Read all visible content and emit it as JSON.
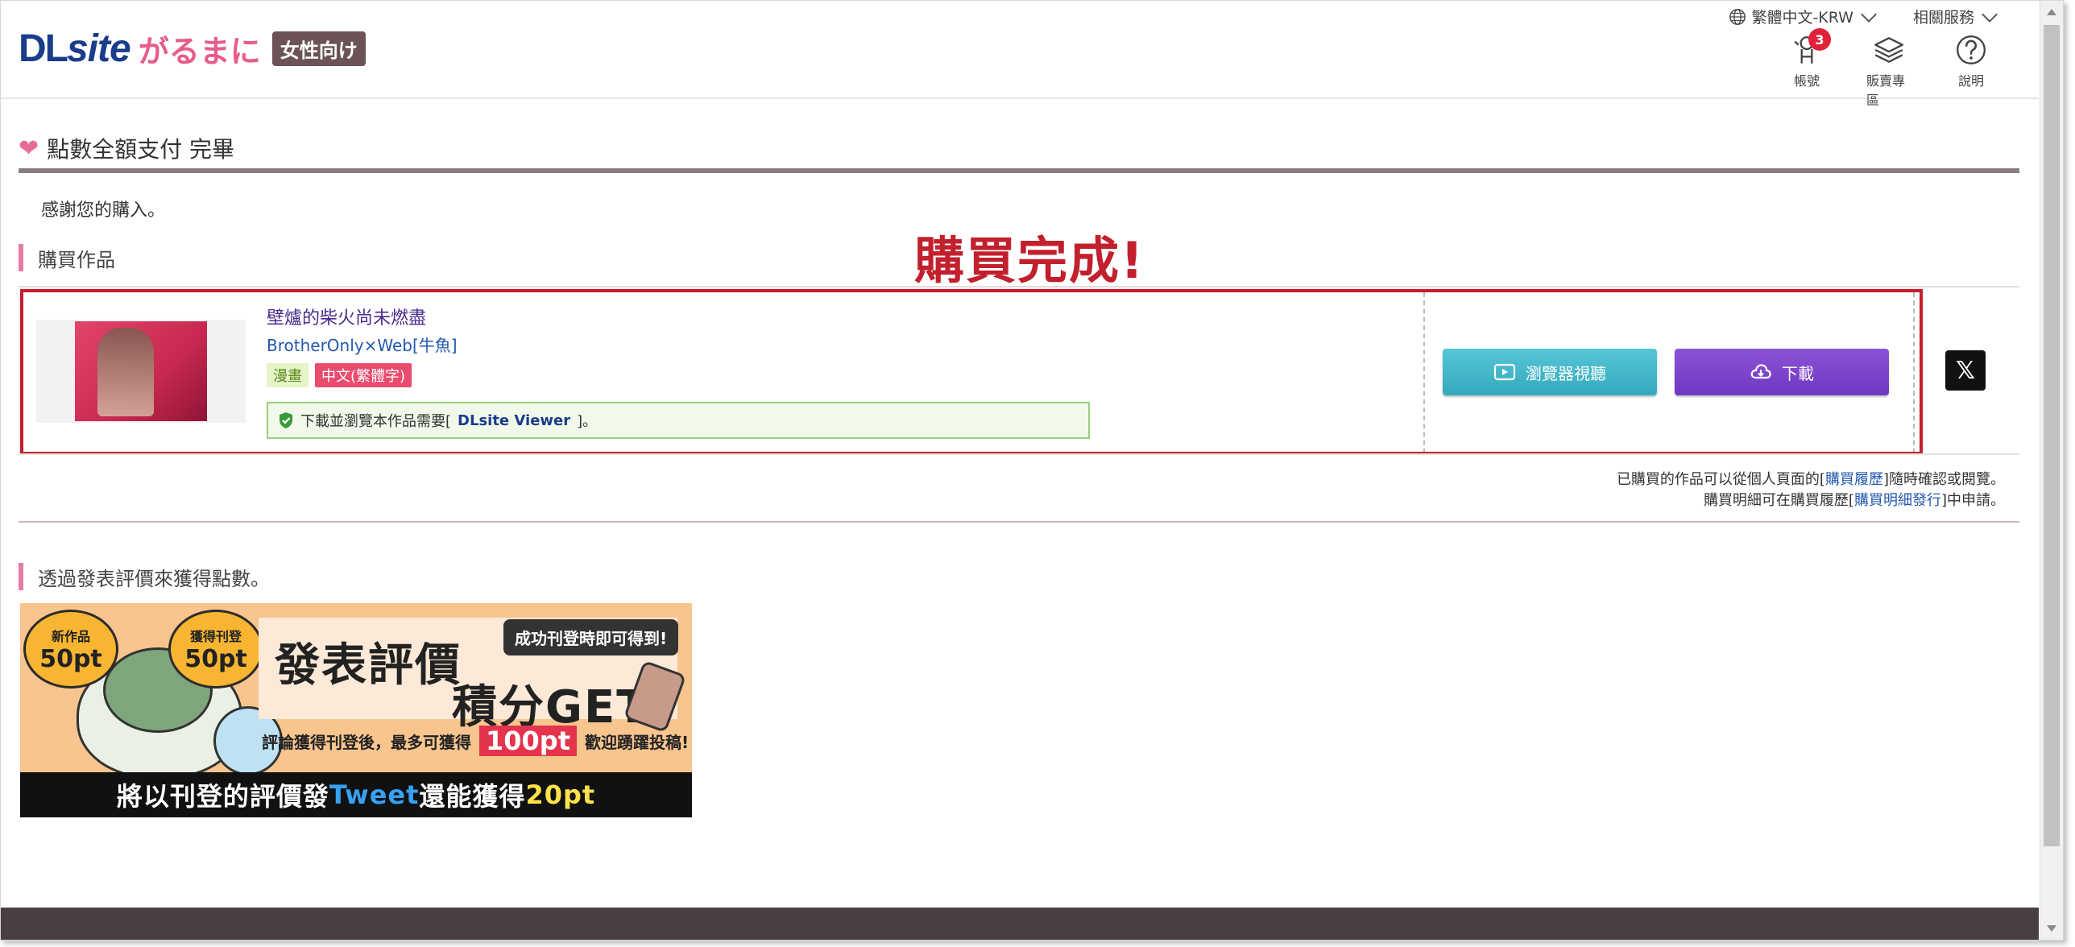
{
  "header": {
    "logo_dl": "DL",
    "logo_site": "site",
    "logo_brand": "がるまに",
    "logo_tag": "女性向け",
    "language": "繁體中文-KRW",
    "related_services": "相關服務",
    "icons": [
      {
        "name": "account-icon",
        "label": "帳號",
        "badge": "3"
      },
      {
        "name": "layers-icon",
        "label": "販賣專區"
      },
      {
        "name": "help-icon",
        "label": "說明"
      }
    ]
  },
  "page": {
    "title": "點數全額支付 完畢",
    "thanks": "感謝您的購入。",
    "annotation": "購買完成!",
    "purchased_heading": "購買作品"
  },
  "product": {
    "title": "壁爐的柴火尚未燃盡",
    "circle": "BrotherOnly×Web[牛魚]",
    "tags": [
      "漫畫",
      "中文(繁體字)"
    ],
    "viewer_note_prefix": "下載並瀏覽本作品需要[",
    "viewer_link": "DLsite Viewer",
    "viewer_note_suffix": "]。",
    "btn_view": "瀏覽器視聽",
    "btn_download": "下載",
    "x_label": "𝕏"
  },
  "notes": {
    "line1_prefix": "已購買的作品可以從個人頁面的[",
    "line1_link": "購買履歷",
    "line1_suffix": "]隨時確認或閱覽。",
    "line2_prefix": "購買明細可在購買履歷[",
    "line2_link": "購買明細發行",
    "line2_suffix": "]中申請。"
  },
  "review": {
    "heading": "透過發表評價來獲得點數。",
    "banner": {
      "bubble1_small": "新作品",
      "bubble1_big": "50pt",
      "bubble2_small": "獲得刊登",
      "bubble2_big": "50pt",
      "title1": "發表評價",
      "title2": "積分GET",
      "speech": "成功刊登時即可得到!",
      "line3_prefix": "評論獲得刊登後，最多可獲得",
      "line3_big": "100pt",
      "line3_suffix": "歡迎踴躍投稿!",
      "bottom_prefix": "將以刊登的評價發",
      "bottom_tweet": "Tweet",
      "bottom_mid": "還能獲得",
      "bottom_pt": "20pt"
    }
  },
  "colors": {
    "accent_pink": "#e66d9a",
    "brand_blue": "#1a3c8c",
    "annotation_red": "#c2202c",
    "button_view": "#41b6c9",
    "button_download": "#7a42c9"
  }
}
